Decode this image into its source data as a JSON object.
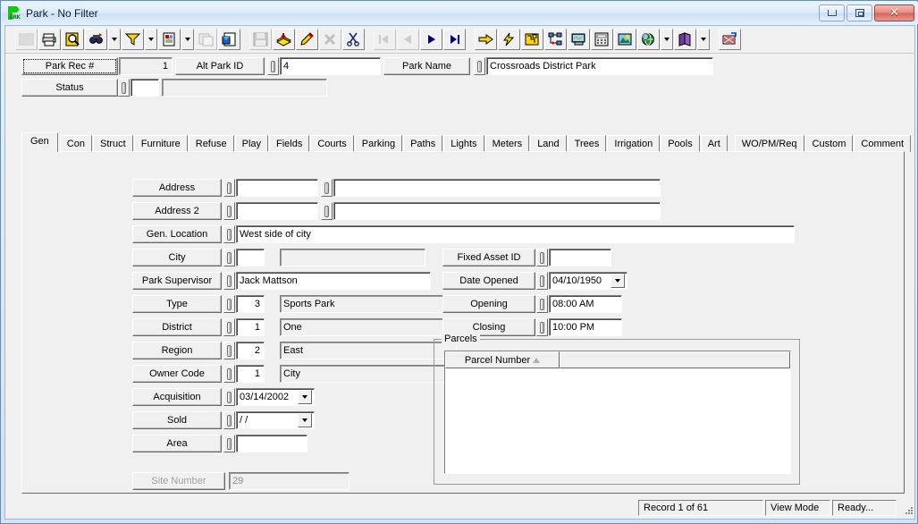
{
  "window": {
    "title": "Park - No Filter",
    "app_icon": "park-logo-icon",
    "minimize_label": "–",
    "restore_label": "❑",
    "close_label": "✕"
  },
  "toolbar": {
    "buttons": [
      {
        "name": "grid-view-icon",
        "tip": "Grid View",
        "enabled": false
      },
      {
        "name": "print-icon",
        "tip": "Print",
        "enabled": true
      },
      {
        "name": "print-preview-icon",
        "tip": "Print Preview",
        "enabled": true
      },
      {
        "name": "find-icon",
        "tip": "Find",
        "enabled": true,
        "dropdown": true
      },
      {
        "name": "filter-icon",
        "tip": "Filter",
        "enabled": true,
        "dropdown": true
      },
      {
        "name": "report-icon",
        "tip": "Report",
        "enabled": true,
        "dropdown": true
      },
      {
        "name": "copy-record-icon",
        "tip": "Copy Record",
        "enabled": false
      },
      {
        "name": "export-icon",
        "tip": "Export",
        "enabled": true
      },
      {
        "name": "save-icon",
        "tip": "Save",
        "enabled": false
      },
      {
        "name": "add-record-icon",
        "tip": "Add Record",
        "enabled": true
      },
      {
        "name": "edit-record-icon",
        "tip": "Edit Record",
        "enabled": true
      },
      {
        "name": "delete-record-icon",
        "tip": "Delete Record",
        "enabled": false
      },
      {
        "name": "cut-icon",
        "tip": "Cut",
        "enabled": true
      },
      {
        "name": "first-record-icon",
        "tip": "First Record",
        "enabled": false
      },
      {
        "name": "previous-record-icon",
        "tip": "Previous Record",
        "enabled": false
      },
      {
        "name": "next-record-icon",
        "tip": "Next Record",
        "enabled": true
      },
      {
        "name": "last-record-icon",
        "tip": "Last Record",
        "enabled": true
      },
      {
        "name": "goto-icon",
        "tip": "Go To",
        "enabled": true
      },
      {
        "name": "quick-action-icon",
        "tip": "Quick Action",
        "enabled": true
      },
      {
        "name": "map-icon",
        "tip": "Map",
        "enabled": true
      },
      {
        "name": "hierarchy-icon",
        "tip": "Hierarchy",
        "enabled": true
      },
      {
        "name": "workstation-icon",
        "tip": "Workstation",
        "enabled": true
      },
      {
        "name": "calculator-icon",
        "tip": "Calculator",
        "enabled": true
      },
      {
        "name": "image-icon",
        "tip": "Image",
        "enabled": true
      },
      {
        "name": "internet-icon",
        "tip": "Internet",
        "enabled": true,
        "dropdown": true
      },
      {
        "name": "help-book-icon",
        "tip": "Help",
        "enabled": true,
        "dropdown": true
      },
      {
        "name": "exit-icon",
        "tip": "Exit",
        "enabled": true
      }
    ]
  },
  "header": {
    "park_rec_label": "Park Rec #",
    "park_rec_value": "1",
    "alt_park_id_label": "Alt Park ID",
    "alt_park_id_value": "4",
    "park_name_label": "Park Name",
    "park_name_value": "Crossroads District Park",
    "status_label": "Status",
    "status_code_value": "",
    "status_desc_value": ""
  },
  "tabs": {
    "active": "Gen",
    "items": [
      {
        "label": "Gen"
      },
      {
        "label": "Con"
      },
      {
        "label": "Struct"
      },
      {
        "label": "Furniture"
      },
      {
        "label": "Refuse"
      },
      {
        "label": "Play"
      },
      {
        "label": "Fields"
      },
      {
        "label": "Courts"
      },
      {
        "label": "Parking"
      },
      {
        "label": "Paths"
      },
      {
        "label": "Lights"
      },
      {
        "label": "Meters"
      },
      {
        "label": "Land"
      },
      {
        "label": "Trees"
      },
      {
        "label": "Irrigation"
      },
      {
        "label": "Pools"
      },
      {
        "label": "Art"
      },
      {
        "label": "WO/PM/Req"
      },
      {
        "label": "Custom"
      },
      {
        "label": "Comment"
      }
    ]
  },
  "general_tab": {
    "left_fields": [
      {
        "label": "Address",
        "code": "",
        "desc": ""
      },
      {
        "label": "Address 2",
        "code": "",
        "desc": ""
      },
      {
        "label": "Gen. Location",
        "value": "West side of city"
      },
      {
        "label": "City",
        "code": "",
        "desc": ""
      },
      {
        "label": "Park Supervisor",
        "value": "Jack Mattson"
      },
      {
        "label": "Type",
        "code": "3",
        "desc": "Sports Park"
      },
      {
        "label": "District",
        "code": "1",
        "desc": "One"
      },
      {
        "label": "Region",
        "code": "2",
        "desc": "East"
      },
      {
        "label": "Owner Code",
        "code": "1",
        "desc": "City"
      },
      {
        "label": "Acquisition",
        "value": "03/14/2002"
      },
      {
        "label": "Sold",
        "value": "  /  /"
      },
      {
        "label": "Area",
        "value": ""
      }
    ],
    "site_number_label": "Site Number",
    "site_number_value": "29",
    "right_fields": [
      {
        "label": "Fixed Asset ID",
        "value": ""
      },
      {
        "label": "Date Opened",
        "value": "04/10/1950"
      },
      {
        "label": "Opening",
        "value": "08:00 AM"
      },
      {
        "label": "Closing",
        "value": "10:00 PM"
      }
    ],
    "parcels": {
      "title": "Parcels",
      "columns": [
        "Parcel Number",
        ""
      ],
      "sort_column": "Parcel Number",
      "sort_direction": "ascending",
      "rows": []
    }
  },
  "statusbar": {
    "record": "Record 1 of 61",
    "mode": "View Mode",
    "state": "Ready..."
  },
  "colors": {
    "face": "#f0f0f0",
    "title_accent": "#6a8caf",
    "close_red": "#d4665a",
    "logo_green": "#00d400"
  }
}
